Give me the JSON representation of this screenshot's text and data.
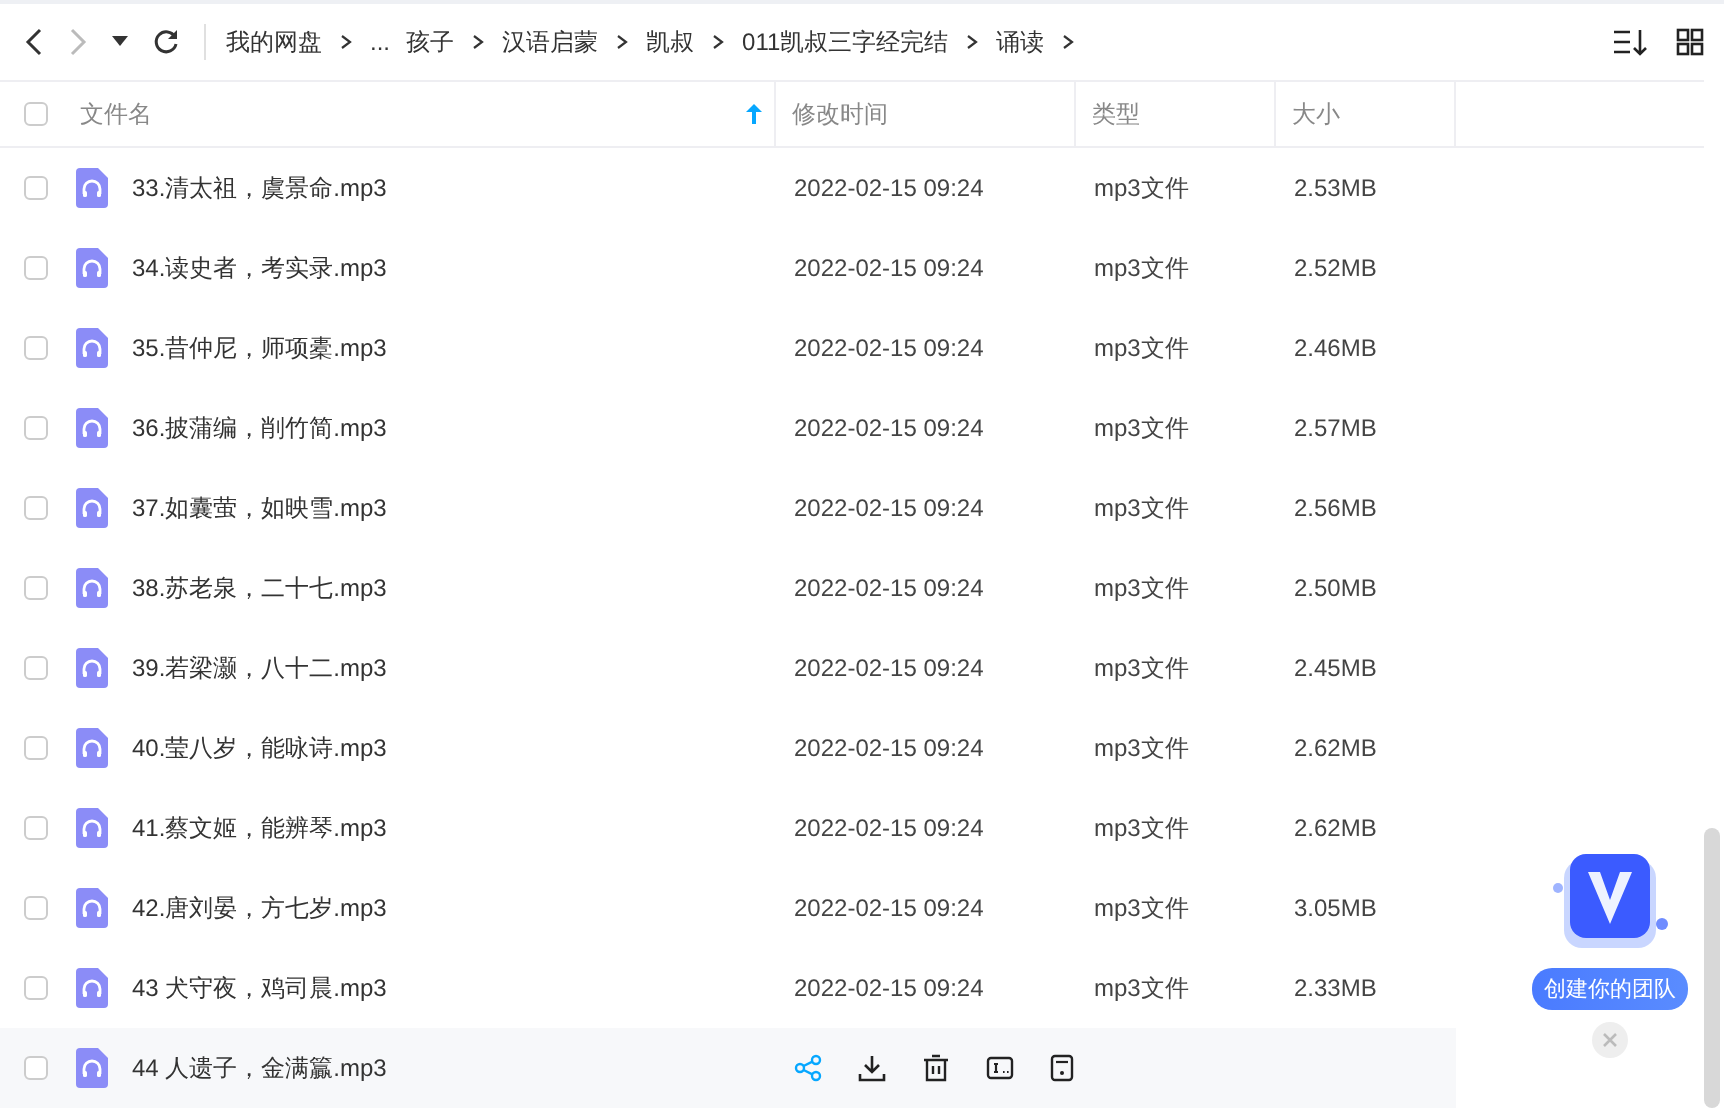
{
  "toolbar": {
    "breadcrumb": [
      "我的网盘",
      "...",
      "孩子",
      "汉语启蒙",
      "凯叔",
      "011凯叔三字经完结",
      "诵读"
    ]
  },
  "table": {
    "select_all_checked": false,
    "columns": [
      {
        "label": "文件名",
        "sorted": true
      },
      {
        "label": "修改时间",
        "sorted": false
      },
      {
        "label": "类型",
        "sorted": false
      },
      {
        "label": "大小",
        "sorted": false
      }
    ],
    "rows": [
      {
        "name": "33.清太祖，虞景命.mp3",
        "modified": "2022-02-15 09:24",
        "type": "mp3文件",
        "size": "2.53MB",
        "checked": false,
        "hovered": false
      },
      {
        "name": "34.读史者，考实录.mp3",
        "modified": "2022-02-15 09:24",
        "type": "mp3文件",
        "size": "2.52MB",
        "checked": false,
        "hovered": false
      },
      {
        "name": "35.昔仲尼，师项橐.mp3",
        "modified": "2022-02-15 09:24",
        "type": "mp3文件",
        "size": "2.46MB",
        "checked": false,
        "hovered": false
      },
      {
        "name": "36.披蒲编，削竹简.mp3",
        "modified": "2022-02-15 09:24",
        "type": "mp3文件",
        "size": "2.57MB",
        "checked": false,
        "hovered": false
      },
      {
        "name": "37.如囊萤，如映雪.mp3",
        "modified": "2022-02-15 09:24",
        "type": "mp3文件",
        "size": "2.56MB",
        "checked": false,
        "hovered": false
      },
      {
        "name": "38.苏老泉，二十七.mp3",
        "modified": "2022-02-15 09:24",
        "type": "mp3文件",
        "size": "2.50MB",
        "checked": false,
        "hovered": false
      },
      {
        "name": "39.若梁灏，八十二.mp3",
        "modified": "2022-02-15 09:24",
        "type": "mp3文件",
        "size": "2.45MB",
        "checked": false,
        "hovered": false
      },
      {
        "name": "40.莹八岁，能咏诗.mp3",
        "modified": "2022-02-15 09:24",
        "type": "mp3文件",
        "size": "2.62MB",
        "checked": false,
        "hovered": false
      },
      {
        "name": "41.蔡文姬，能辨琴.mp3",
        "modified": "2022-02-15 09:24",
        "type": "mp3文件",
        "size": "2.62MB",
        "checked": false,
        "hovered": false
      },
      {
        "name": "42.唐刘晏，方七岁.mp3",
        "modified": "2022-02-15 09:24",
        "type": "mp3文件",
        "size": "3.05MB",
        "checked": false,
        "hovered": false
      },
      {
        "name": "43 犬守夜，鸡司晨.mp3",
        "modified": "2022-02-15 09:24",
        "type": "mp3文件",
        "size": "2.33MB",
        "checked": false,
        "hovered": false
      },
      {
        "name": "44 人遗子，金满籯.mp3",
        "checked": false,
        "hovered": true
      }
    ]
  },
  "promo": {
    "label": "创建你的团队"
  }
}
